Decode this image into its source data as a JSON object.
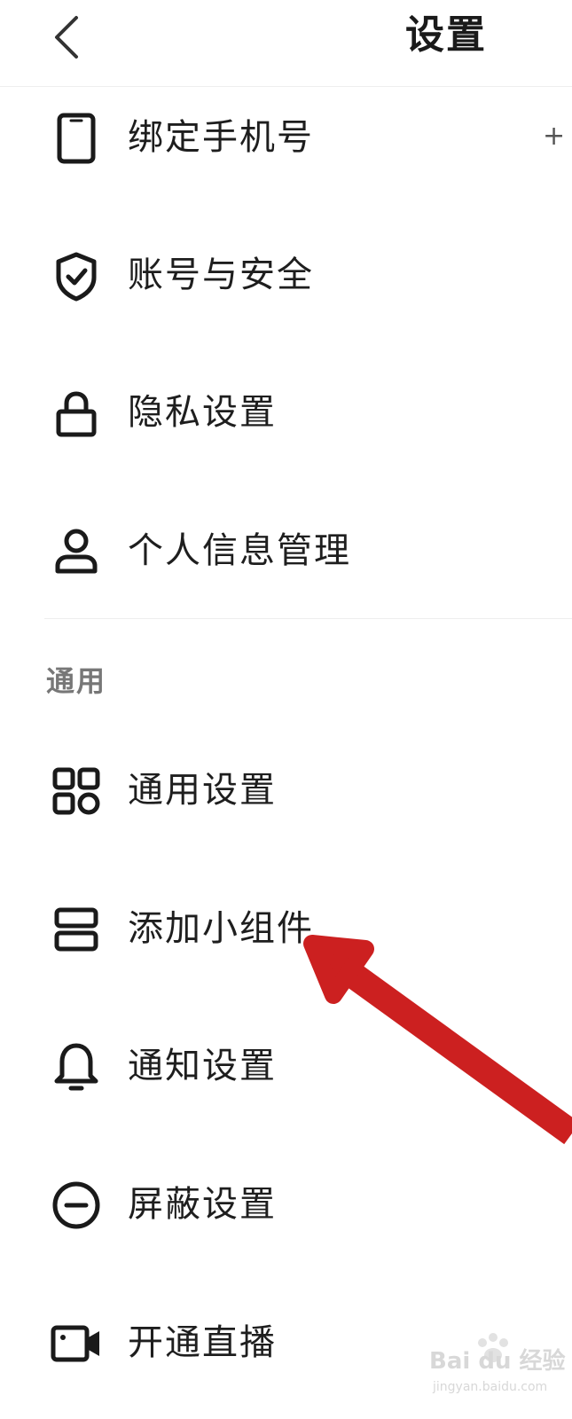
{
  "header": {
    "title": "设置",
    "back_icon": "chevron-left-icon"
  },
  "account_items": [
    {
      "label": "绑定手机号",
      "icon": "phone-icon",
      "trailing": "+"
    },
    {
      "label": "账号与安全",
      "icon": "shield-check-icon"
    },
    {
      "label": "隐私设置",
      "icon": "lock-icon"
    },
    {
      "label": "个人信息管理",
      "icon": "person-icon"
    }
  ],
  "general_section": {
    "title": "通用",
    "items": [
      {
        "label": "通用设置",
        "icon": "grid-icon"
      },
      {
        "label": "添加小组件",
        "icon": "widget-icon"
      },
      {
        "label": "通知设置",
        "icon": "bell-icon"
      },
      {
        "label": "屏蔽设置",
        "icon": "block-icon"
      },
      {
        "label": "开通直播",
        "icon": "video-camera-icon"
      }
    ]
  },
  "annotation": {
    "type": "arrow",
    "color": "#cc2020",
    "points_to": "添加小组件"
  },
  "watermark": {
    "text": "Bai du 经验",
    "sub": "jingyan.baidu.com"
  }
}
